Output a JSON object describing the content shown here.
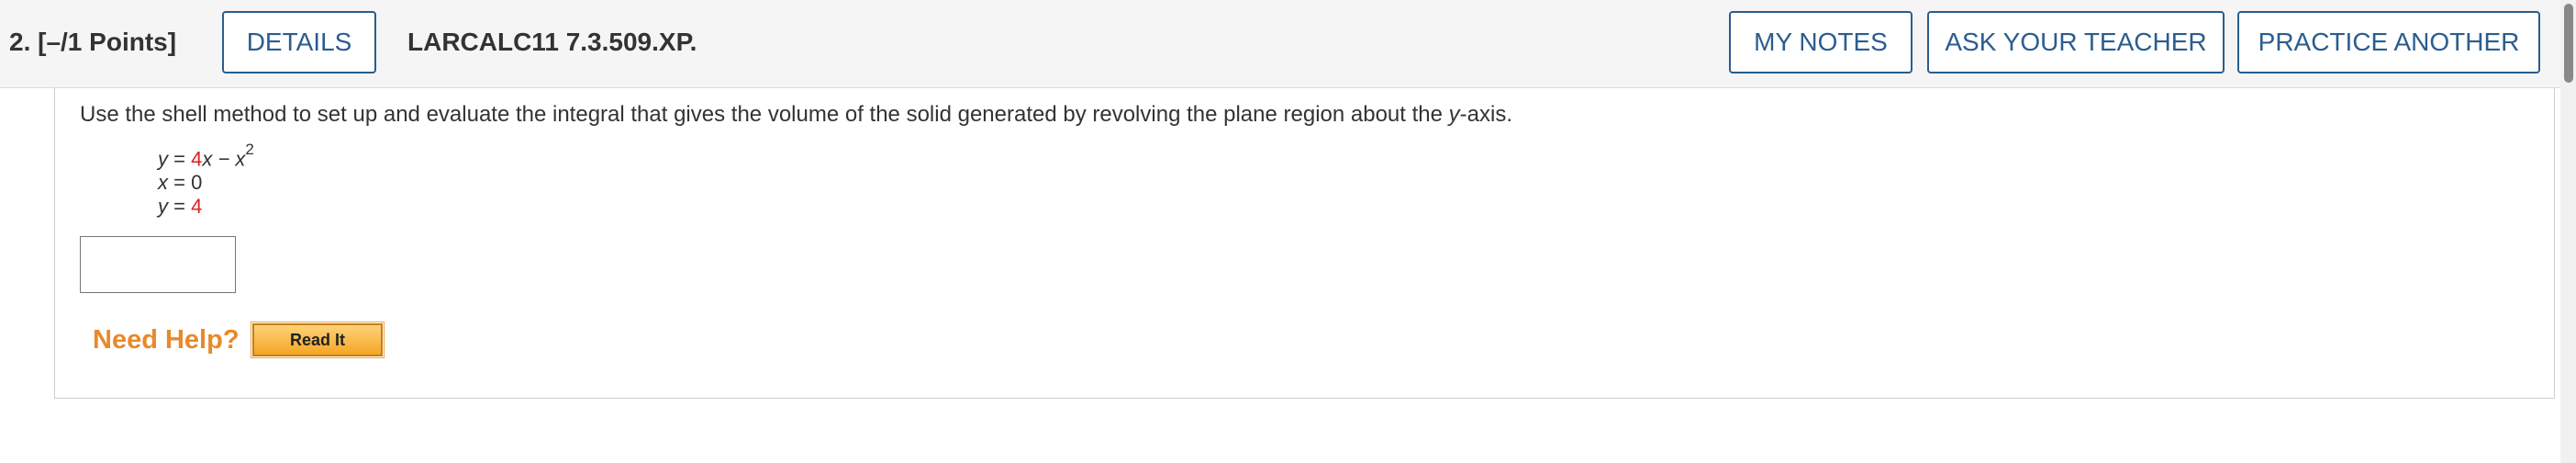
{
  "header": {
    "question_label": "2. [–/1 Points]",
    "details_label": "DETAILS",
    "problem_id": "LARCALC11 7.3.509.XP.",
    "my_notes_label": "MY NOTES",
    "ask_teacher_label": "ASK YOUR TEACHER",
    "practice_label": "PRACTICE ANOTHER"
  },
  "problem": {
    "prompt_before": "Use the shell method to set up and evaluate the integral that gives the volume of the solid generated by revolving the plane region about the ",
    "prompt_var": "y",
    "prompt_after": "-axis.",
    "equations": [
      {
        "lhs": "y",
        "op": " = ",
        "coef": "4",
        "var": "x",
        "rest": " − x",
        "exp": "2"
      },
      {
        "lhs": "x",
        "op": " = ",
        "value": "0"
      },
      {
        "lhs": "y",
        "op": " = ",
        "value": "4"
      }
    ],
    "answer_value": ""
  },
  "help": {
    "need_help_label": "Need Help?",
    "read_it_label": "Read It"
  },
  "colors": {
    "accent": "#2a5d8f",
    "highlight": "#dd2222",
    "help": "#e8892b"
  }
}
